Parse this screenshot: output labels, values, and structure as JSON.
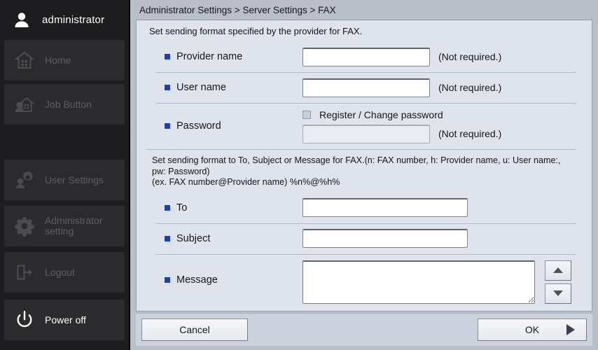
{
  "sidebar": {
    "user": {
      "name": "administrator",
      "icon": "user-icon"
    },
    "items": [
      {
        "label": "Home",
        "icon": "home-icon",
        "state": "dim"
      },
      {
        "label": "Job Button",
        "icon": "job-button-icon",
        "state": "dim"
      },
      {
        "label": "User Settings",
        "icon": "user-settings-icon",
        "state": "dim"
      },
      {
        "label": "Administrator setting",
        "icon": "gear-icon",
        "state": "dim"
      },
      {
        "label": "Logout",
        "icon": "logout-icon",
        "state": "dim"
      },
      {
        "label": "Power off",
        "icon": "power-icon",
        "state": "active"
      }
    ]
  },
  "breadcrumb": "Administrator Settings > Server Settings > FAX",
  "main": {
    "intro": "Set sending format specified by the provider for FAX.",
    "fields": [
      {
        "label": "Provider name",
        "value": "",
        "note": "(Not required.)"
      },
      {
        "label": "User name",
        "value": "",
        "note": "(Not required.)"
      }
    ],
    "password": {
      "label": "Password",
      "checkbox_label": "Register / Change password",
      "checked": false,
      "value": "",
      "note": "(Not required.)"
    },
    "instructions": {
      "line1": "Set sending format to To, Subject or Message for FAX.(n: FAX number, h: Provider name, u: User name:,",
      "line2": "pw: Password)",
      "line3": "(ex. FAX number@Provider name) %n%@%h%"
    },
    "format_fields": [
      {
        "label": "To",
        "value": ""
      },
      {
        "label": "Subject",
        "value": ""
      }
    ],
    "message": {
      "label": "Message",
      "value": ""
    },
    "spinner": {
      "up": "scroll-up-icon",
      "down": "scroll-down-icon"
    }
  },
  "footer": {
    "cancel_label": "Cancel",
    "ok_label": "OK"
  },
  "colors": {
    "accent_bullet": "#1c3fb7",
    "panel_bg": "#dfe3ec",
    "window_bg": "#b9bec9",
    "sidebar_bg": "#1d1d1f",
    "sidebar_item_bg": "#2b2b2d"
  }
}
